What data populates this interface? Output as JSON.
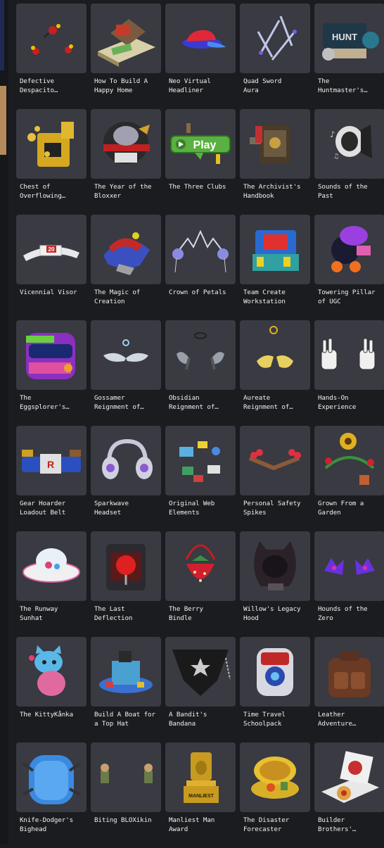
{
  "catalog": {
    "items": [
      {
        "name": "Defective\nDespacito…",
        "icon": "red-beetle-icon"
      },
      {
        "name": "How To Build A\nHappy Home",
        "icon": "diorama-hat-icon"
      },
      {
        "name": "Neo Virtual\nHeadliner",
        "icon": "red-cap-icon"
      },
      {
        "name": "Quad Sword\nAura",
        "icon": "sword-aura-icon"
      },
      {
        "name": "The\nHuntmaster's…",
        "icon": "hunt-headphones-icon"
      },
      {
        "name": "Chest of\nOverflowing…",
        "icon": "gold-chest-icon"
      },
      {
        "name": "The Year of the\nBloxxer",
        "icon": "bloxxer-helmet-icon"
      },
      {
        "name": "The Three Clubs",
        "icon": "play-sign-icon",
        "badge": "Play"
      },
      {
        "name": "The Archivist's\nHandbook",
        "icon": "handbook-icon"
      },
      {
        "name": "Sounds of the\nPast",
        "icon": "speaker-icon"
      },
      {
        "name": "Vicennial Visor",
        "icon": "visor-icon",
        "badge": "20"
      },
      {
        "name": "The Magic of\nCreation",
        "icon": "creation-hat-icon"
      },
      {
        "name": "Crown of Petals",
        "icon": "petal-crown-icon"
      },
      {
        "name": "Team Create\nWorkstation",
        "icon": "workstation-icon"
      },
      {
        "name": "Towering Pillar\nof UGC",
        "icon": "ugc-pillar-icon"
      },
      {
        "name": "The\nEggsplorer's…",
        "icon": "eggsplorer-helmet-icon"
      },
      {
        "name": "Gossamer\nReignment of…",
        "icon": "silver-mustache-icon"
      },
      {
        "name": "Obsidian\nReignment of…",
        "icon": "obsidian-wings-icon"
      },
      {
        "name": "Aureate\nReignment of…",
        "icon": "gold-mustache-icon"
      },
      {
        "name": "Hands-On\nExperience",
        "icon": "peace-hands-icon"
      },
      {
        "name": "Gear Hoarder\nLoadout Belt",
        "icon": "gear-belt-icon"
      },
      {
        "name": "Sparkwave\nHeadset",
        "icon": "headset-icon"
      },
      {
        "name": "Original Web\nElements",
        "icon": "web-elements-icon"
      },
      {
        "name": "Personal Safety\nSpikes",
        "icon": "spikes-icon"
      },
      {
        "name": "Grown From a\nGarden",
        "icon": "garden-icon"
      },
      {
        "name": "The Runway\nSunhat",
        "icon": "sunhat-icon"
      },
      {
        "name": "The Last\nDeflection",
        "icon": "deflection-icon"
      },
      {
        "name": "The Berry\nBindle",
        "icon": "strawberry-bag-icon"
      },
      {
        "name": "Willow's Legacy\nHood",
        "icon": "cat-hood-icon"
      },
      {
        "name": "Hounds of the\nZero",
        "icon": "hounds-icon"
      },
      {
        "name": "The KittyKånka",
        "icon": "kitty-icon"
      },
      {
        "name": "Build A Boat for\na Top Hat",
        "icon": "boat-tophat-icon"
      },
      {
        "name": "A Bandit's\nBandana",
        "icon": "bandana-icon"
      },
      {
        "name": "Time Travel\nSchoolpack",
        "icon": "schoolpack-icon"
      },
      {
        "name": "Leather\nAdventure…",
        "icon": "leather-backpack-icon"
      },
      {
        "name": "Knife-Dodger's\nBighead",
        "icon": "bighead-icon"
      },
      {
        "name": "Biting BLOXikin",
        "icon": "bloxikin-icon"
      },
      {
        "name": "Manliest Man\nAward",
        "icon": "trophy-icon",
        "badge": "MANLIEST"
      },
      {
        "name": "The Disaster\nForecaster",
        "icon": "forecaster-icon"
      },
      {
        "name": "Builder\nBrothers'…",
        "icon": "pizza-box-icon"
      }
    ]
  },
  "colors": {
    "background": "#1b1c1f",
    "tile": "#393a42",
    "text": "#f1f1f1"
  }
}
